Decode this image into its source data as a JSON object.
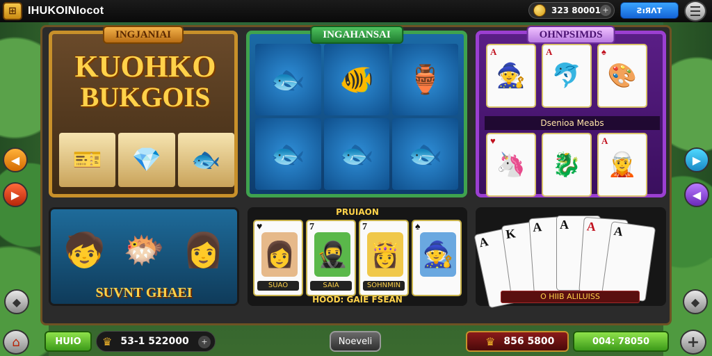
{
  "topbar": {
    "app_title": "IHUKOINIocot",
    "coin_value": "323 80001",
    "blue_button": "ƧıЯΛТ"
  },
  "panels": {
    "left": {
      "tab": "INGJANIAI",
      "title_line1": "KUOHKO",
      "title_line2": "BUKGOIS",
      "symbols": [
        "🎫",
        "💎",
        "🐟"
      ]
    },
    "middle": {
      "tab": "INGAHANSAI",
      "reels": [
        "🐟",
        "🐠",
        "🏺",
        "🐟",
        "🐟",
        "🐟"
      ]
    },
    "right": {
      "tab": "OHNPSIMDS",
      "caption": "Dsenioa Meabs",
      "top_cards": [
        {
          "corner": "A",
          "face": "🧙"
        },
        {
          "corner": "A",
          "face": "🐬"
        },
        {
          "corner": "♠",
          "face": "🎨"
        }
      ],
      "bottom_cards": [
        {
          "corner": "♥",
          "face": "🦄"
        },
        {
          "corner": "",
          "face": "🐉"
        },
        {
          "corner": "A",
          "face": "🧝"
        }
      ]
    }
  },
  "bottom_panels": {
    "left": {
      "title": "SUVNT GHAEI",
      "art": [
        "🧒",
        "🐡",
        "👩"
      ]
    },
    "middle": {
      "header": "PRUIAON",
      "footer": "HOOD: GAIE FSEAN",
      "cards": [
        {
          "corner": "♥",
          "face": "👩",
          "label": "SUAO"
        },
        {
          "corner": "7",
          "face": "🥷",
          "label": "SAIA"
        },
        {
          "corner": "7",
          "face": "👸",
          "label": "SOHNMIN"
        },
        {
          "corner": "♠",
          "face": "🧙",
          "label": ""
        }
      ]
    },
    "right": {
      "footer": "O HIIB ALILUISS",
      "cards": [
        "A",
        "K",
        "A",
        "A",
        "A",
        "A"
      ]
    }
  },
  "side_nav": {
    "left_up": "◀",
    "left_down": "▶",
    "right_up": "▶",
    "right_down": "◀"
  },
  "bottombar": {
    "green_button": "HUIO",
    "balance": "53-1 522000",
    "center_button": "Noeveli",
    "red_value": "856 5800",
    "green_value": "004: 78050"
  }
}
